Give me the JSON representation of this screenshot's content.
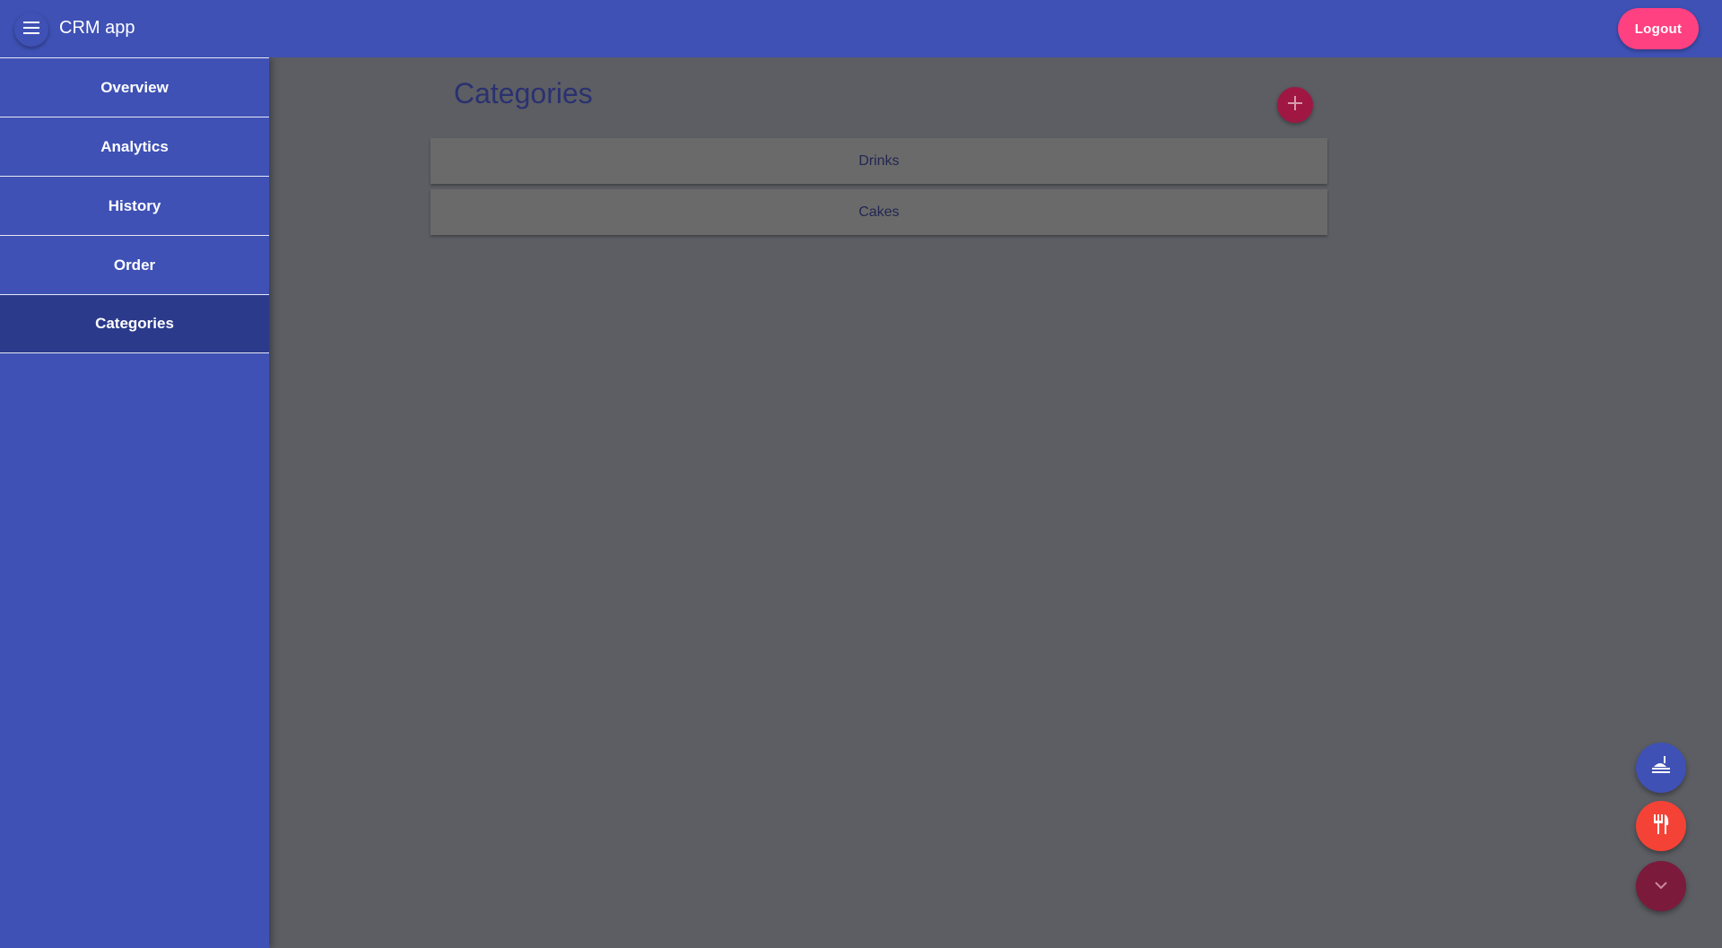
{
  "header": {
    "app_title": "CRM app",
    "menu_icon": "hamburger-menu-icon",
    "logout_label": "Logout"
  },
  "sidebar": {
    "items": [
      {
        "label": "Overview",
        "active": false
      },
      {
        "label": "Analytics",
        "active": false
      },
      {
        "label": "History",
        "active": false
      },
      {
        "label": "Order",
        "active": false
      },
      {
        "label": "Categories",
        "active": true
      }
    ]
  },
  "main": {
    "page_title": "Categories",
    "add_icon": "plus-icon",
    "categories": [
      {
        "label": "Drinks"
      },
      {
        "label": "Cakes"
      }
    ]
  },
  "fabs": [
    {
      "icon": "food-service-icon",
      "color": "#3f51b5"
    },
    {
      "icon": "restaurant-icon",
      "color": "#f44336"
    },
    {
      "icon": "chevron-down-icon",
      "color": "#7b1a3b"
    }
  ],
  "colors": {
    "primary": "#3f51b5",
    "accent": "#ff4081",
    "sidebar_active": "#2c3a8c",
    "overlay": "#5c5e63"
  }
}
